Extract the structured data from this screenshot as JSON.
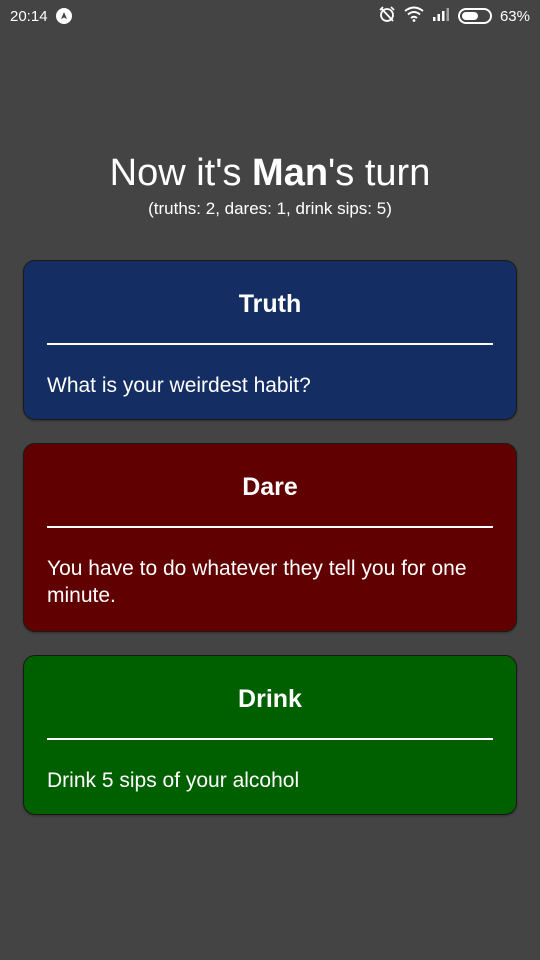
{
  "status_bar": {
    "time": "20:14",
    "battery": "63%",
    "battery_fraction": 0.63,
    "icons": [
      "notification-icon",
      "alarm-off-icon",
      "wifi-icon",
      "signal-icon",
      "battery-icon"
    ]
  },
  "header": {
    "title_prefix": "Now it's ",
    "player_name": "Man",
    "title_suffix": "'s turn",
    "stats": "(truths: 2, dares: 1, drink sips: 5)"
  },
  "cards": {
    "truth": {
      "title": "Truth",
      "text": "What is your weirdest habit?",
      "color": "#142d63"
    },
    "dare": {
      "title": "Dare",
      "text": "You have to do whatever they tell you for one minute.",
      "color": "#600000"
    },
    "drink": {
      "title": "Drink",
      "text": "Drink 5 sips of your alcohol",
      "color": "#006000"
    }
  },
  "colors": {
    "background": "#444444",
    "text": "#ffffff"
  }
}
